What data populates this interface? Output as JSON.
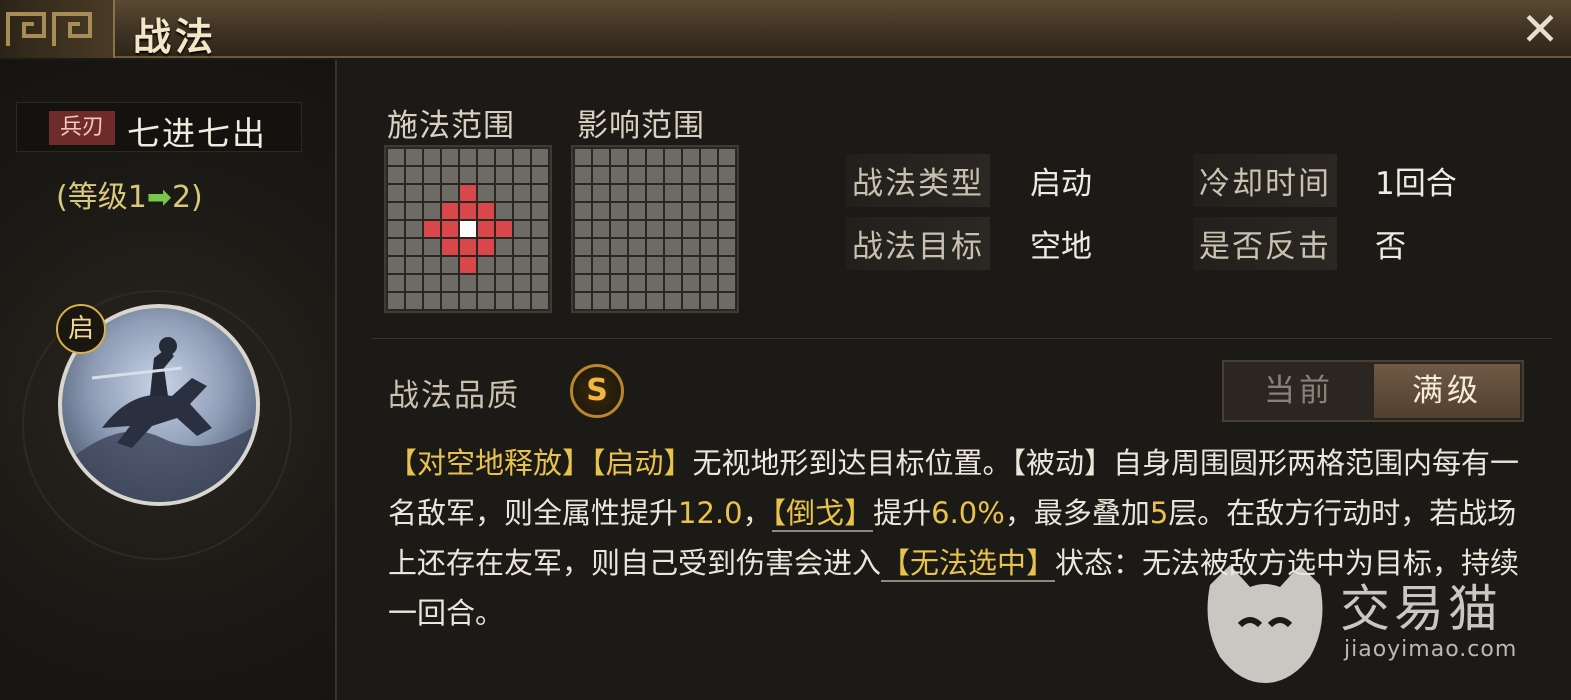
{
  "window": {
    "title": "战法",
    "close_icon": "close-icon"
  },
  "skill": {
    "weapon_tag": "兵刃",
    "name": "七进七出",
    "level_prefix": "(等级1",
    "level_arrow": "➡",
    "level_suffix": "2)",
    "type_badge": "启"
  },
  "ranges": {
    "cast_label": "施法范围",
    "effect_label": "影响范围"
  },
  "attributes": {
    "type_label": "战法类型",
    "type_value": "启动",
    "cooldown_label": "冷却时间",
    "cooldown_value": "1回合",
    "target_label": "战法目标",
    "target_value": "空地",
    "counter_label": "是否反击",
    "counter_value": "否"
  },
  "quality": {
    "label": "战法品质",
    "grade": "S"
  },
  "toggle": {
    "current": "当前",
    "max": "满级",
    "selected": "满级"
  },
  "description": {
    "p1": "【对空地释放】",
    "p2": "【启动】",
    "p3": "无视地形到达目标位置。【被动】自身周围圆形两格范围内每有一名敌军，则全属性提升",
    "n1": "12.0",
    "p4": "，",
    "p5": "【倒戈】",
    "p6": "提升",
    "n2": "6.0%",
    "p7": "，最多叠加",
    "n3": "5",
    "p8": "层。在敌方行动时，若战场上还存在友军，则自己受到伤害会进入",
    "p9": "【无法选中】",
    "p10": "状态：无法被敌方选中为目标，持续一回合。"
  },
  "watermark": {
    "text": "交易猫",
    "url": "jiaoyimao.com"
  },
  "colors": {
    "keyword": "#e8c24a",
    "range_cell": "#d9474a",
    "level_arrow": "#7ac64a"
  }
}
